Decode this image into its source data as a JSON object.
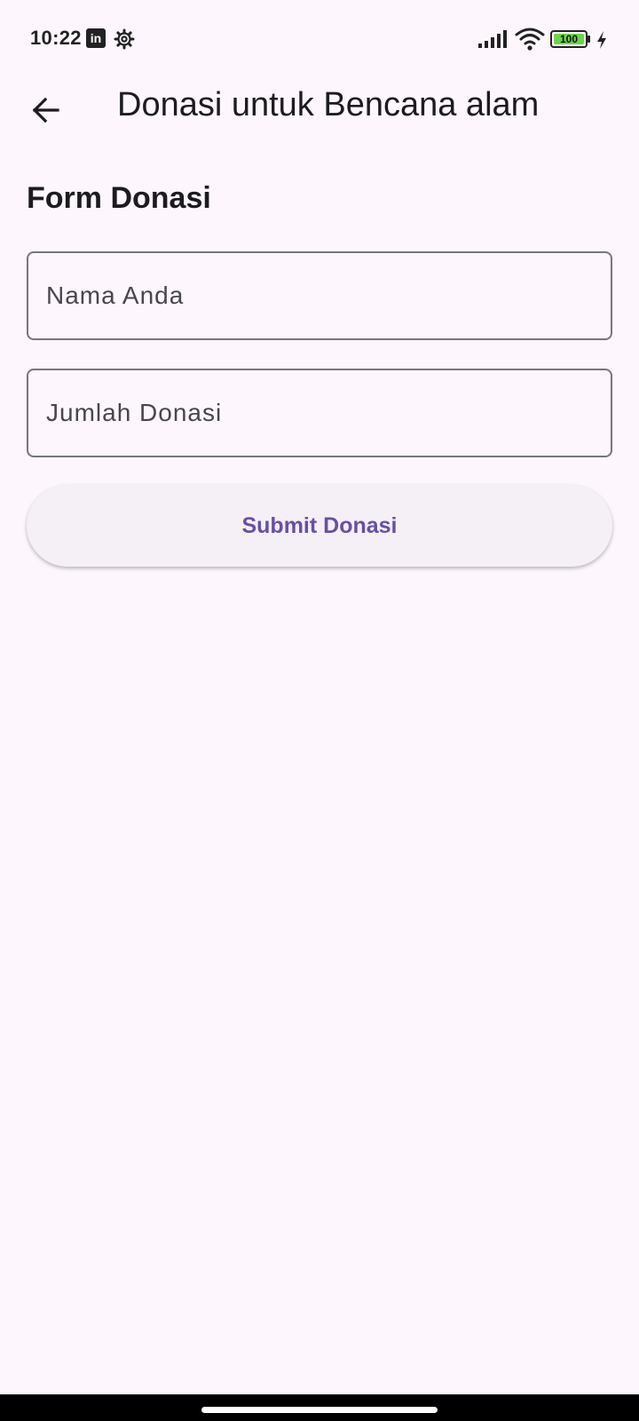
{
  "status_bar": {
    "time": "10:22",
    "battery_level": "100",
    "icons": [
      "linkedin-icon",
      "gear-icon",
      "signal-icon",
      "wifi-icon",
      "battery-icon",
      "charging-icon"
    ]
  },
  "app_bar": {
    "back_icon": "arrow-left-icon",
    "title": "Donasi untuk Bencana alam"
  },
  "form": {
    "heading": "Form Donasi",
    "name_field": {
      "placeholder": "Nama Anda",
      "value": ""
    },
    "amount_field": {
      "placeholder": "Jumlah Donasi",
      "value": ""
    },
    "submit_label": "Submit Donasi"
  },
  "colors": {
    "background": "#fdf7fd",
    "primary": "#6750a4",
    "outline": "#79747e",
    "button_surface": "#f4f0f6",
    "battery_fill": "#6bd44a"
  }
}
